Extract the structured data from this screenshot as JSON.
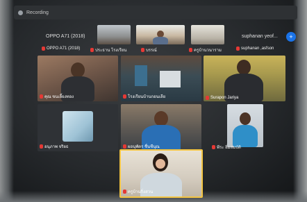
{
  "meeting": {
    "recording_label": "Recording"
  },
  "header_names": [
    {
      "text": "OPPO A71 (2018)"
    },
    {
      "text": "suphanan yeof..."
    }
  ],
  "top_strip": [
    {
      "text": "OPPO A71 (2018)"
    },
    {
      "text": "ประธาน โรงเรียน"
    },
    {
      "text": "บรรณ์"
    },
    {
      "text": "ครูบ้านวนาราม"
    },
    {
      "text": "suphanan ,asfson"
    }
  ],
  "tiles": [
    {
      "name": "คุณ ขนเลี้ยงทอง"
    },
    {
      "name": "โรงเรียนบ้านกอนเลีย"
    },
    {
      "name": "Surapon Jariya"
    },
    {
      "name": "อนุภาพ จริยธ"
    },
    {
      "name": "ผอนุพัตร ชื่นชีนุณ"
    },
    {
      "name": "พีระ อิ่มสมบัติ"
    },
    {
      "name": "ครูบ้านกิ่งสวน"
    }
  ],
  "colors": {
    "accent": "#1a73e8",
    "mic_muted": "#e53935",
    "tile_bg": "#3c4043"
  },
  "icons": {
    "record": "record-dot-icon",
    "mic_off": "mic-off-icon",
    "add": "add-icon"
  }
}
